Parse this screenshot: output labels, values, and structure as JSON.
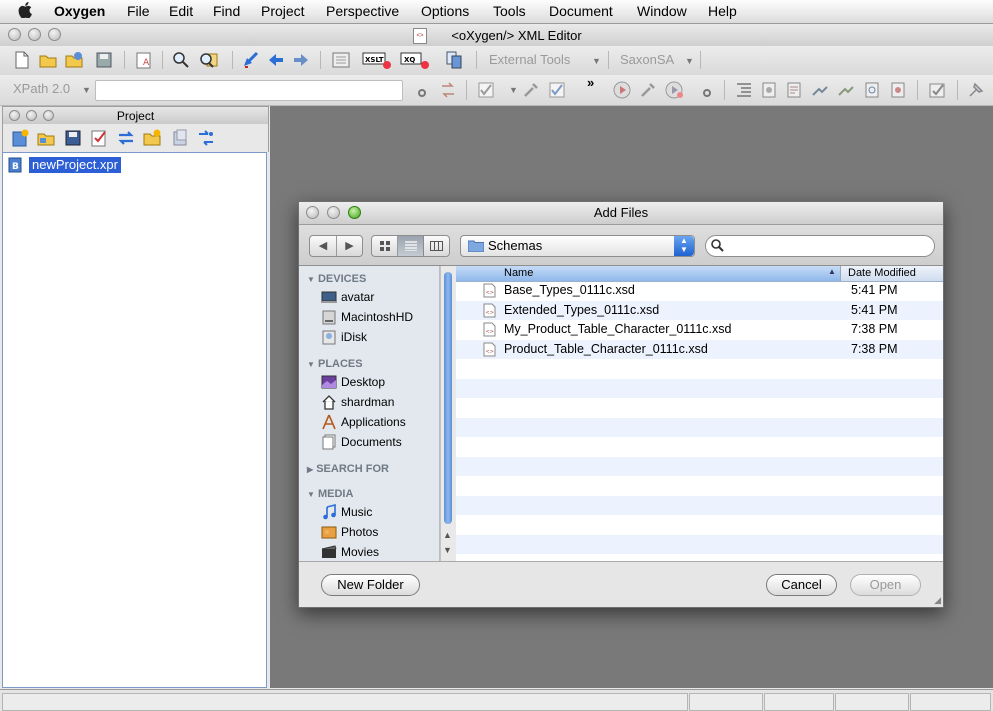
{
  "menubar": {
    "app_name": "Oxygen",
    "items": [
      "File",
      "Edit",
      "Find",
      "Project",
      "Perspective",
      "Options",
      "Tools",
      "Document",
      "Window",
      "Help"
    ]
  },
  "window": {
    "title": "<oXygen/> XML Editor"
  },
  "toolbar": {
    "external_tools": "External Tools",
    "transformer": "SaxonSA",
    "xpath_version": "XPath 2.0",
    "xpath_value": "",
    "overflow": "»"
  },
  "project": {
    "title": "Project",
    "item": "newProject.xpr"
  },
  "dialog": {
    "title": "Add Files",
    "location": "Schemas",
    "search_value": "",
    "sidebar": {
      "devices_header": "DEVICES",
      "devices": [
        "avatar",
        "MacintoshHD",
        "iDisk"
      ],
      "places_header": "PLACES",
      "places": [
        "Desktop",
        "shardman",
        "Applications",
        "Documents"
      ],
      "search_header": "SEARCH FOR",
      "media_header": "MEDIA",
      "media": [
        "Music",
        "Photos",
        "Movies"
      ]
    },
    "columns": {
      "name": "Name",
      "date": "Date Modified"
    },
    "files": [
      {
        "name": "Base_Types_0111c.xsd",
        "date": "5:41 PM"
      },
      {
        "name": "Extended_Types_0111c.xsd",
        "date": "5:41 PM"
      },
      {
        "name": "My_Product_Table_Character_0111c.xsd",
        "date": "7:38 PM"
      },
      {
        "name": "Product_Table_Character_0111c.xsd",
        "date": "7:38 PM"
      }
    ],
    "new_folder": "New Folder",
    "cancel": "Cancel",
    "open": "Open"
  },
  "colors": {
    "selection": "#2c5fd6",
    "workspace": "#797979",
    "row_stripe": "#edf3fe"
  }
}
